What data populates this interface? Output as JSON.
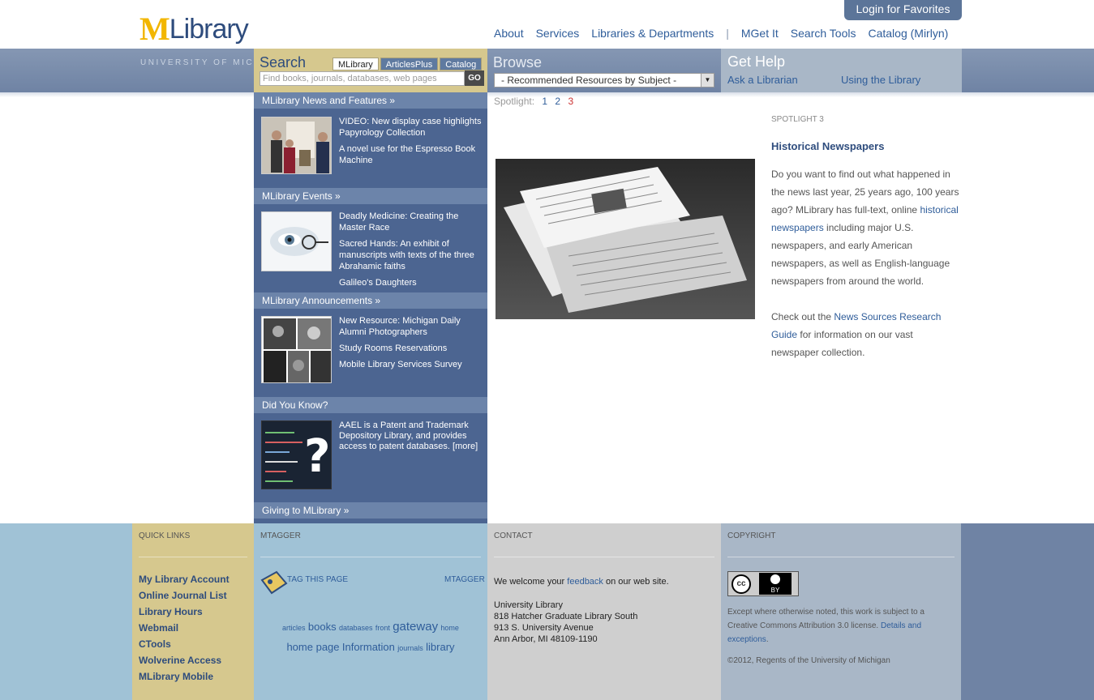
{
  "header": {
    "logo_m": "M",
    "logo_text": "Library",
    "university": "UNIVERSITY OF MICHIGAN",
    "login": "Login for Favorites",
    "nav": [
      "About",
      "Services",
      "Libraries & Departments",
      "|",
      "MGet It",
      "Search Tools",
      "Catalog (Mirlyn)"
    ]
  },
  "search": {
    "title": "Search",
    "tabs": [
      "MLibrary",
      "ArticlesPlus",
      "Catalog"
    ],
    "placeholder": "Find books, journals, databases, web pages",
    "go": "GO"
  },
  "browse": {
    "title": "Browse",
    "select_value": "- Recommended Resources by Subject -"
  },
  "help": {
    "title": "Get Help",
    "ask": "Ask a Librarian",
    "using": "Using the Library"
  },
  "left": {
    "news": {
      "head": "MLibrary News and Features »",
      "items": [
        "VIDEO: New display case highlights Papyrology Collection",
        "A novel use for the Espresso Book Machine"
      ]
    },
    "events": {
      "head": "MLibrary Events »",
      "items": [
        "Deadly Medicine: Creating the Master Race",
        "Sacred Hands: An exhibit of manuscripts with texts of the three Abrahamic faiths",
        "Galileo's Daughters"
      ]
    },
    "announcements": {
      "head": "MLibrary Announcements »",
      "items": [
        "New Resource: Michigan Daily Alumni Photographers",
        "Study Rooms Reservations",
        "Mobile Library Services Survey"
      ]
    },
    "know": {
      "head": "Did You Know?",
      "text": "AAEL is a Patent and Trademark Depository Library, and provides access to patent databases. [more]"
    },
    "giving": {
      "head": "Giving to MLibrary »"
    }
  },
  "spotlight": {
    "nav_label": "Spotlight:",
    "pages": [
      "1",
      "2",
      "3"
    ],
    "label": "SPOTLIGHT 3",
    "title": "Historical Newspapers",
    "p1_a": "Do you want to find out what happened in the news last year, 25 years ago, 100 years ago? MLibrary has full-text, online ",
    "p1_link": "historical newspapers",
    "p1_b": " including major U.S. newspapers, and early American newspapers, as well as English-language newspapers from around the world.",
    "p2_a": "Check out the ",
    "p2_link": "News Sources Research Guide",
    "p2_b": " for information on our vast newspaper collection."
  },
  "footer": {
    "quick": {
      "head": "QUICK LINKS",
      "items": [
        "My Library Account",
        "Online Journal List",
        "Library Hours",
        "Webmail",
        "CTools",
        "Wolverine Access",
        "MLibrary Mobile"
      ]
    },
    "mtagger": {
      "head": "MTAGGER",
      "tag_this": "TAG THIS PAGE",
      "link": "MTAGGER",
      "tags": [
        "articles",
        "books",
        "databases",
        "front",
        "gateway",
        "home",
        "home page",
        "Information",
        "journals",
        "library"
      ]
    },
    "contact": {
      "head": "CONTACT",
      "welcome_a": "We welcome your ",
      "welcome_link": "feedback",
      "welcome_b": " on our web site.",
      "address": [
        "University Library",
        "818 Hatcher Graduate Library South",
        "913 S. University Avenue",
        "Ann Arbor, MI 48109-1190"
      ]
    },
    "copyright": {
      "head": "COPYRIGHT",
      "cc_label": "cc",
      "by_label": "BY",
      "text_a": "Except where otherwise noted, this work is subject to a Creative Commons Attribution 3.0 license. ",
      "text_link": "Details and exceptions",
      "text_b": ".",
      "year": "©2012, Regents of the University of Michigan"
    }
  },
  "colors": {
    "navy": "#2e4c7d",
    "maize": "#f2b600",
    "panel": "#4c6591",
    "footer_blue": "#a0c2d6"
  }
}
